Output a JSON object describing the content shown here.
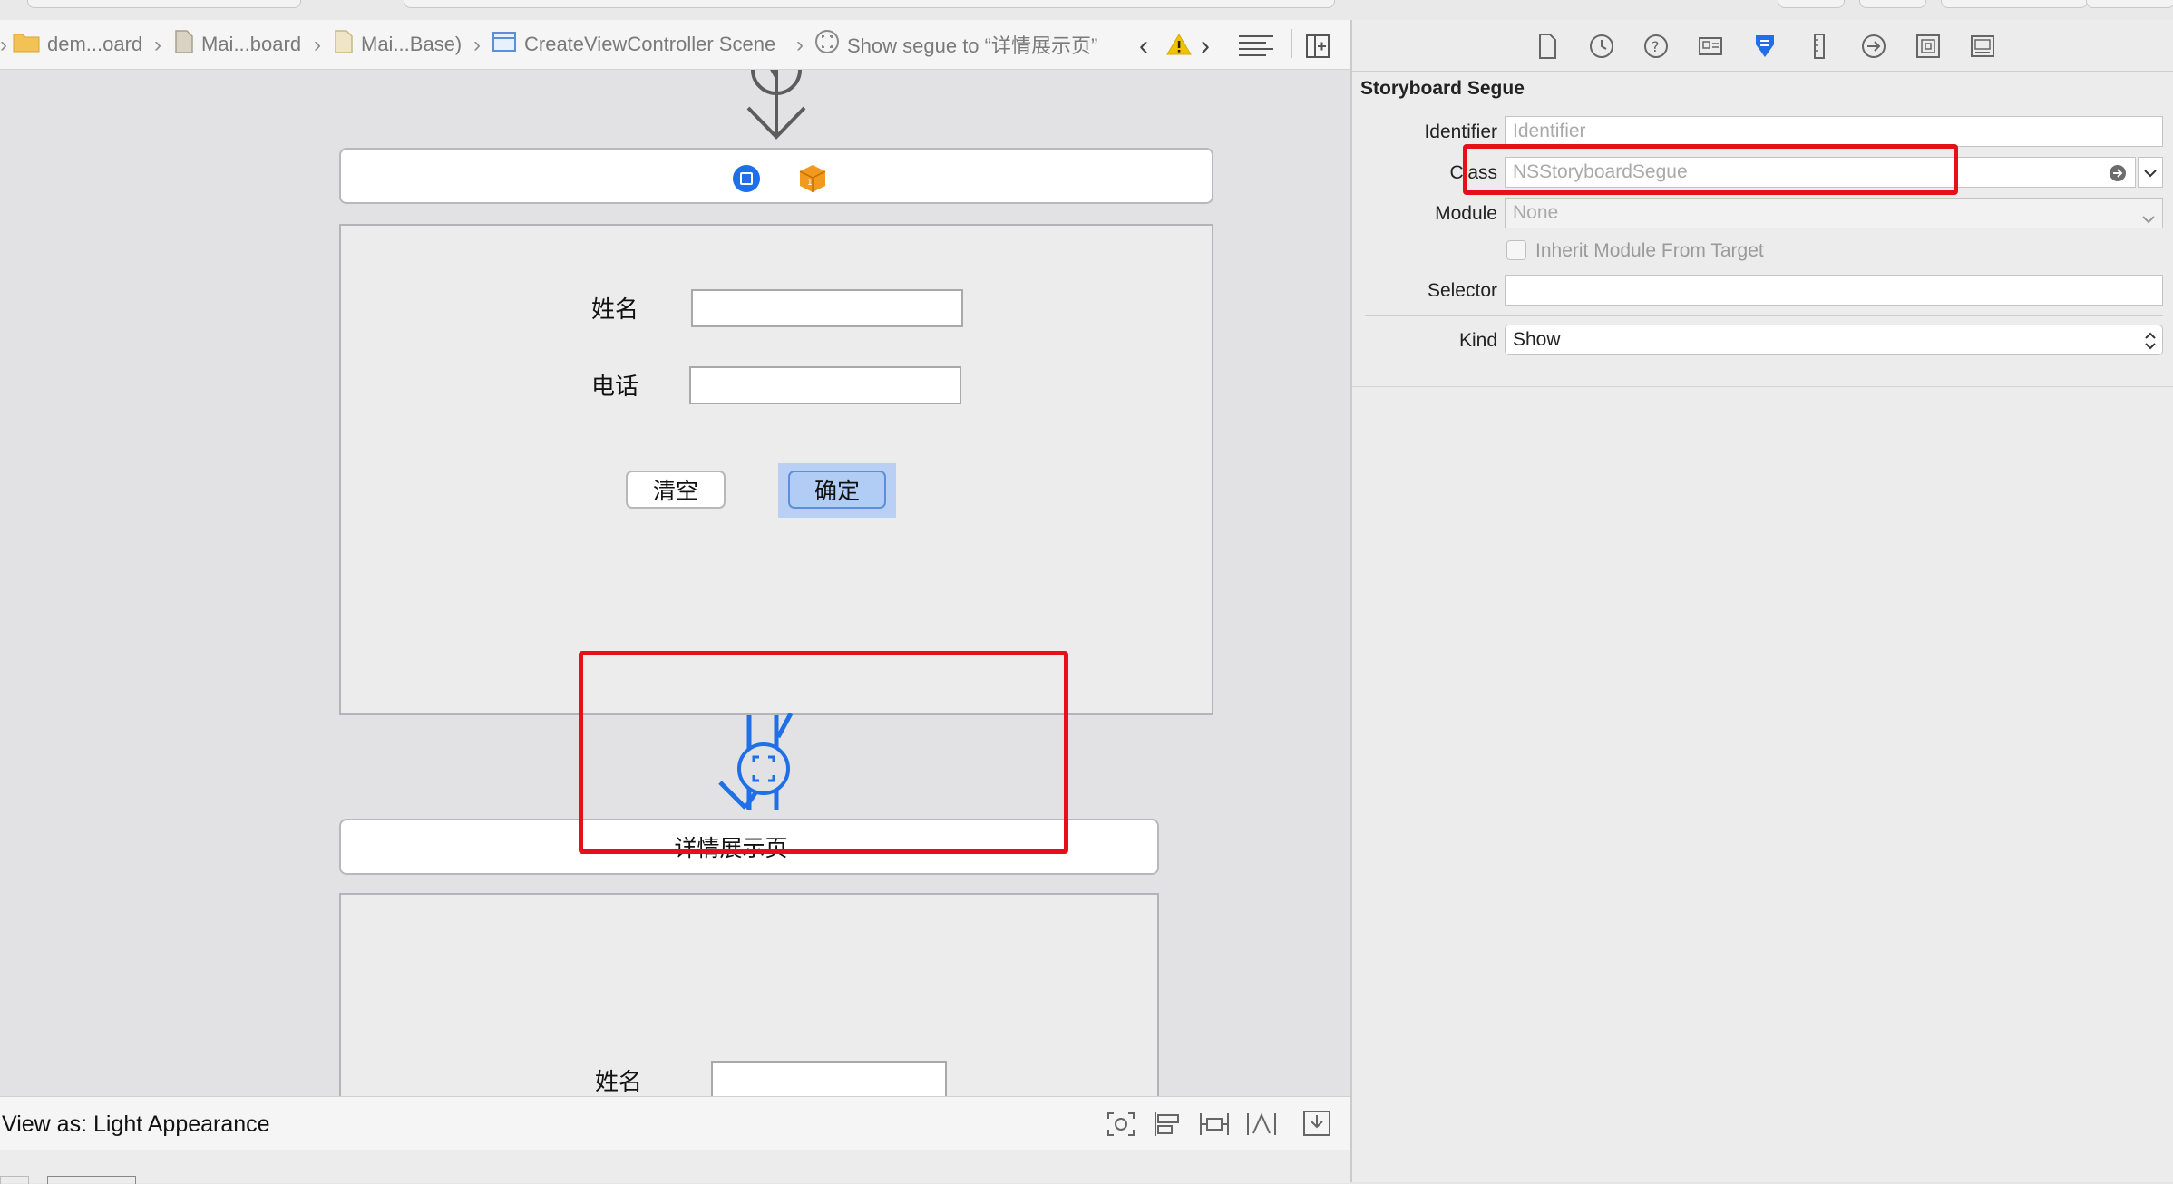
{
  "breadcrumbs": [
    {
      "label": "dem...oard",
      "icon": "folder-icon"
    },
    {
      "label": "Mai...board",
      "icon": "storyboard-file-icon"
    },
    {
      "label": "Mai...Base)",
      "icon": "storyboard-file-icon"
    },
    {
      "label": "CreateViewController Scene",
      "icon": "scene-icon"
    },
    {
      "label": "Show segue to “详情展示页”",
      "icon": "segue-icon"
    }
  ],
  "scene1": {
    "name_label": "姓名",
    "phone_label": "电话",
    "clear_button": "清空",
    "confirm_button": "确定"
  },
  "scene2": {
    "title": "详情展示页",
    "name_label": "姓名"
  },
  "bottom": {
    "view_as": "View as: Light Appearance"
  },
  "inspector": {
    "section_title": "Storyboard Segue",
    "identifier_label": "Identifier",
    "identifier_placeholder": "Identifier",
    "class_label": "Class",
    "class_placeholder": "NSStoryboardSegue",
    "module_label": "Module",
    "module_value": "None",
    "inherit_label": "Inherit Module From Target",
    "inherit_checked": false,
    "selector_label": "Selector",
    "selector_value": "",
    "kind_label": "Kind",
    "kind_value": "Show"
  },
  "colors": {
    "accent_blue": "#1f6fe8",
    "highlight_red": "#e5101a",
    "warning_yellow": "#f2c200"
  }
}
